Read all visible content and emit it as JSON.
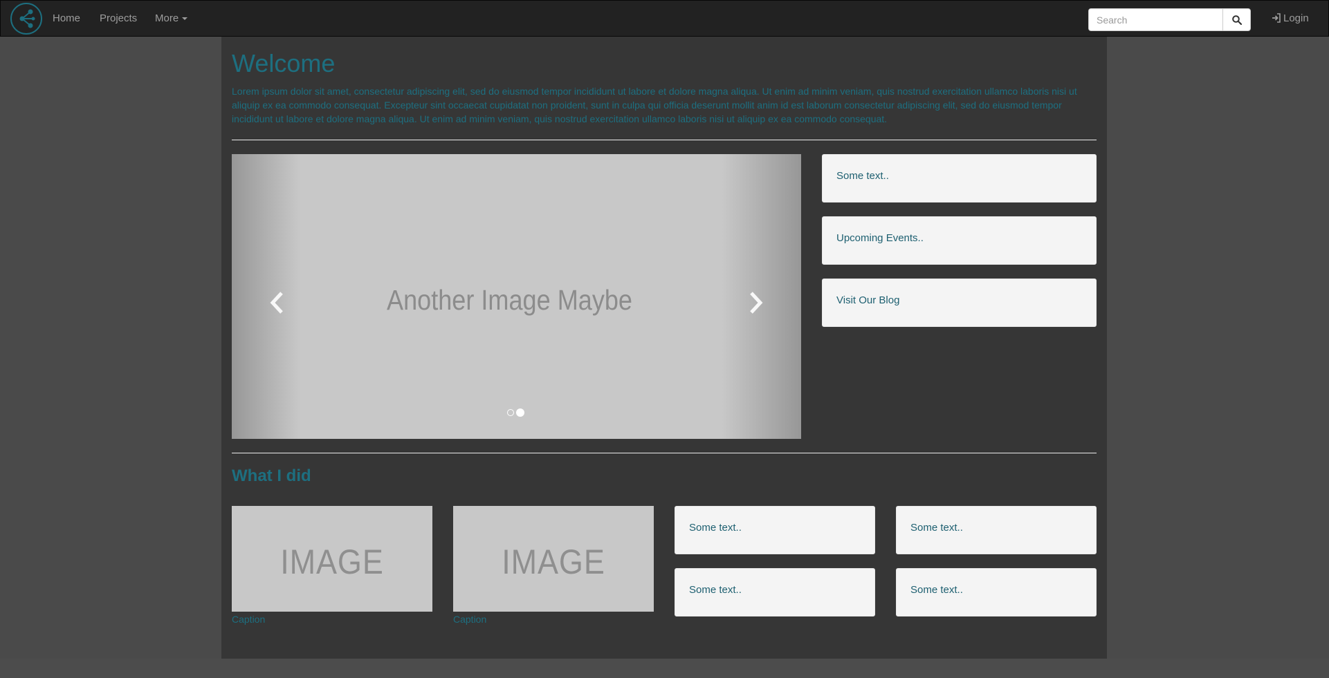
{
  "navbar": {
    "home": "Home",
    "projects": "Projects",
    "more": "More",
    "search_placeholder": "Search",
    "login": "Login"
  },
  "main": {
    "title": "Welcome",
    "intro": "Lorem ipsum dolor sit amet, consectetur adipiscing elit, sed do eiusmod tempor incididunt ut labore et dolore magna aliqua. Ut enim ad minim veniam, quis nostrud exercitation ullamco laboris nisi ut aliquip ex ea commodo consequat. Excepteur sint occaecat cupidatat non proident, sunt in culpa qui officia deserunt mollit anim id est laborum consectetur adipiscing elit, sed do eiusmod tempor incididunt ut labore et dolore magna aliqua. Ut enim ad minim veniam, quis nostrud exercitation ullamco laboris nisi ut aliquip ex ea commodo consequat.",
    "carousel": {
      "slide_text": "Another Image Maybe",
      "active_index": 1,
      "slide_count": 2
    },
    "side_wells": [
      "Some text..",
      "Upcoming Events..",
      "Visit Our Blog"
    ],
    "section_title": "What I did",
    "thumbnails": [
      {
        "image_text": "IMAGE",
        "caption": "Caption"
      },
      {
        "image_text": "IMAGE",
        "caption": "Caption"
      }
    ],
    "grid_wells": [
      "Some text..",
      "Some text..",
      "Some text..",
      "Some text.."
    ]
  },
  "colors": {
    "accent": "#1d6f80",
    "navbar_bg": "#222222",
    "container_bg": "#363636",
    "page_bg": "#4a4a4a"
  }
}
